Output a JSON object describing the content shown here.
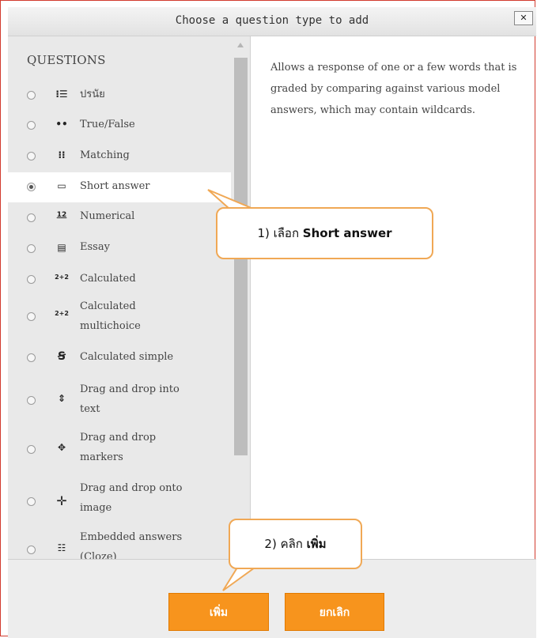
{
  "dialog": {
    "title": "Choose a question type to add",
    "close_label": "✕"
  },
  "questions": {
    "heading": "QUESTIONS",
    "selected_index": 3,
    "items": [
      {
        "label": "ปรนัย",
        "icon": "multichoice-icon",
        "glyph": "⁝☰"
      },
      {
        "label": "True/False",
        "icon": "truefalse-icon",
        "glyph": "••"
      },
      {
        "label": "Matching",
        "icon": "matching-icon",
        "glyph": "⁝⁝"
      },
      {
        "label": "Short answer",
        "icon": "shortanswer-icon",
        "glyph": "▭"
      },
      {
        "label": "Numerical",
        "icon": "numerical-icon",
        "glyph": "12"
      },
      {
        "label": "Essay",
        "icon": "essay-icon",
        "glyph": "▤"
      },
      {
        "label": "Calculated",
        "icon": "calculated-icon",
        "glyph": "2+2"
      },
      {
        "label": "Calculated multichoice",
        "icon": "calculatedmulti-icon",
        "glyph": "2+2"
      },
      {
        "label": "Calculated simple",
        "icon": "calculatedsimple-icon",
        "glyph": "Ꞩ"
      },
      {
        "label": "Drag and drop into text",
        "icon": "ddwtos-icon",
        "glyph": "⇕"
      },
      {
        "label": "Drag and drop markers",
        "icon": "ddmarker-icon",
        "glyph": "✥"
      },
      {
        "label": "Drag and drop onto image",
        "icon": "ddimageortext-icon",
        "glyph": "✛"
      },
      {
        "label": "Embedded answers (Cloze)",
        "icon": "cloze-icon",
        "glyph": "☷"
      }
    ]
  },
  "description": "Allows a response of one or a few words that is graded by comparing against various model answers, which may contain wildcards.",
  "buttons": {
    "add": "เพิ่ม",
    "cancel": "ยกเลิก"
  },
  "callouts": {
    "step1_prefix": "1)  เลือก ",
    "step1_bold": "Short answer",
    "step2_prefix": "2)  คลิก ",
    "step2_bold": "เพิ่ม"
  },
  "colors": {
    "accent": "#f7941d",
    "callout_border": "#f0a855",
    "dialog_border": "#d23b2e"
  }
}
